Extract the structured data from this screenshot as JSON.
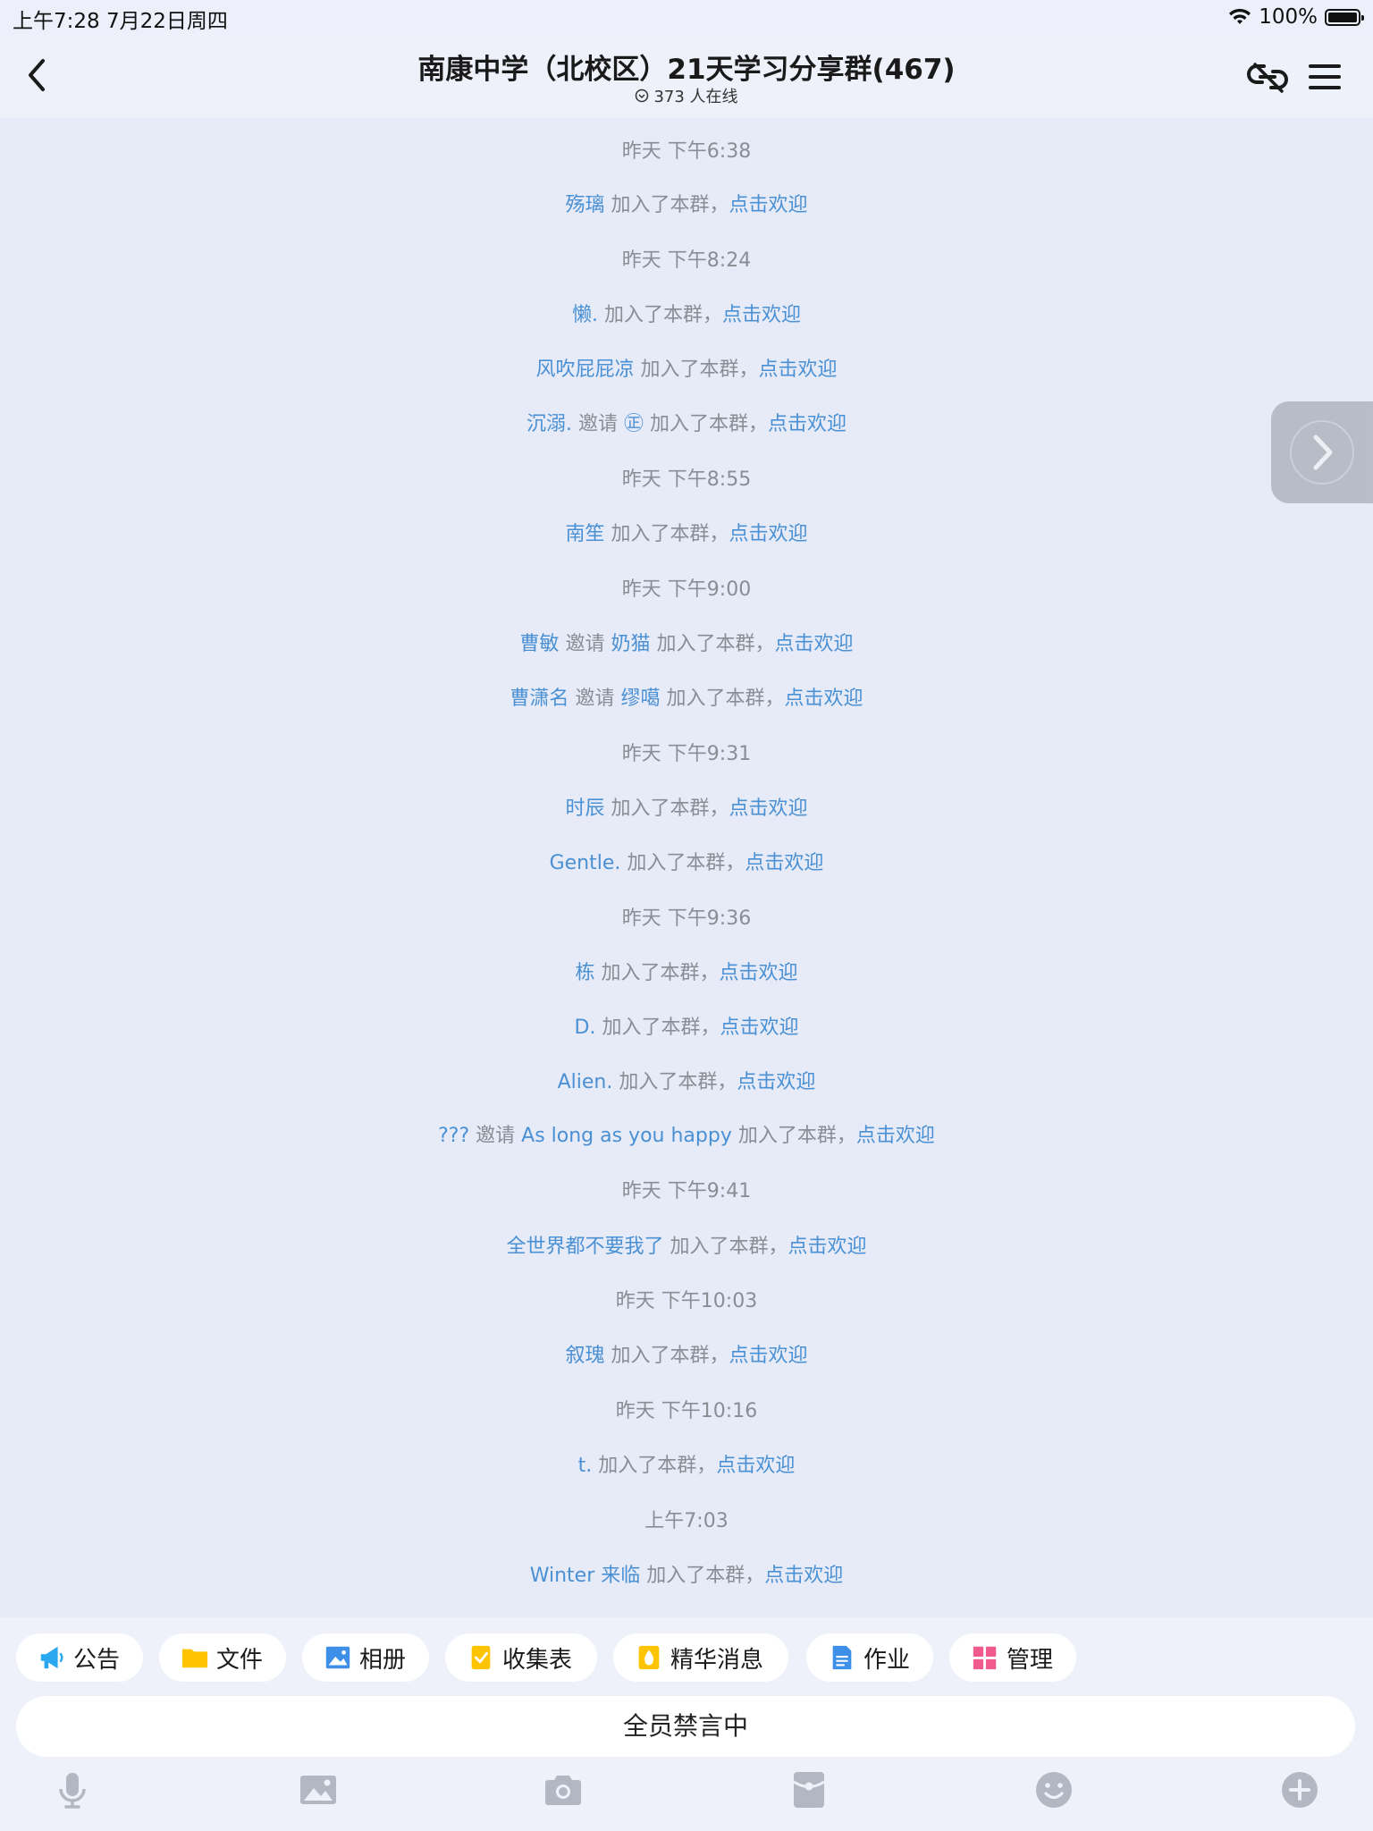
{
  "status_bar": {
    "time": "上午7:28   7月22日周四",
    "battery": "100%"
  },
  "header": {
    "title": "南康中学（北校区）21天学习分享群(467)",
    "online": "373 人在线"
  },
  "chat": {
    "welcome_text": "点击欢迎",
    "joined_text": "加入了本群，",
    "invite_text": "邀请",
    "messages": [
      {
        "kind": "time",
        "text": "昨天 下午6:38"
      },
      {
        "kind": "join",
        "name": "殇璃"
      },
      {
        "kind": "time",
        "text": "昨天 下午8:24"
      },
      {
        "kind": "join",
        "name": "懒."
      },
      {
        "kind": "join",
        "name": "风吹屁屁凉"
      },
      {
        "kind": "invite",
        "inviter": "沉溺.",
        "name": "㊣"
      },
      {
        "kind": "time",
        "text": "昨天 下午8:55"
      },
      {
        "kind": "join",
        "name": "南笙"
      },
      {
        "kind": "time",
        "text": "昨天 下午9:00"
      },
      {
        "kind": "invite",
        "inviter": "曹敏",
        "name": "奶猫"
      },
      {
        "kind": "invite",
        "inviter": "曹潇名",
        "name": "缪噶"
      },
      {
        "kind": "time",
        "text": "昨天 下午9:31"
      },
      {
        "kind": "join",
        "name": "时辰"
      },
      {
        "kind": "join",
        "name": "Gentle."
      },
      {
        "kind": "time",
        "text": "昨天 下午9:36"
      },
      {
        "kind": "join",
        "name": "栋"
      },
      {
        "kind": "join",
        "name": "D."
      },
      {
        "kind": "join",
        "name": "Alien."
      },
      {
        "kind": "invite",
        "inviter": "???",
        "name": "As long as you happy"
      },
      {
        "kind": "time",
        "text": "昨天 下午9:41"
      },
      {
        "kind": "join",
        "name": "全世界都不要我了"
      },
      {
        "kind": "time",
        "text": "昨天 下午10:03"
      },
      {
        "kind": "join",
        "name": "叙瑰"
      },
      {
        "kind": "time",
        "text": "昨天 下午10:16"
      },
      {
        "kind": "join",
        "name": "t."
      },
      {
        "kind": "time",
        "text": "上午7:03"
      },
      {
        "kind": "join",
        "name": "Winter  来临"
      }
    ]
  },
  "toolbar": {
    "chips": [
      {
        "label": "公告",
        "icon": "megaphone-icon",
        "color": "#29a8f0"
      },
      {
        "label": "文件",
        "icon": "folder-icon",
        "color": "#ffc400"
      },
      {
        "label": "相册",
        "icon": "album-icon",
        "color": "#3d8fe8"
      },
      {
        "label": "收集表",
        "icon": "form-icon",
        "color": "#ffc400"
      },
      {
        "label": "精华消息",
        "icon": "essence-icon",
        "color": "#ffc400"
      },
      {
        "label": "作业",
        "icon": "homework-icon",
        "color": "#3d8fe8"
      },
      {
        "label": "管理",
        "icon": "manage-icon",
        "color": "#f05a8c"
      }
    ],
    "mute_text": "全员禁言中"
  }
}
